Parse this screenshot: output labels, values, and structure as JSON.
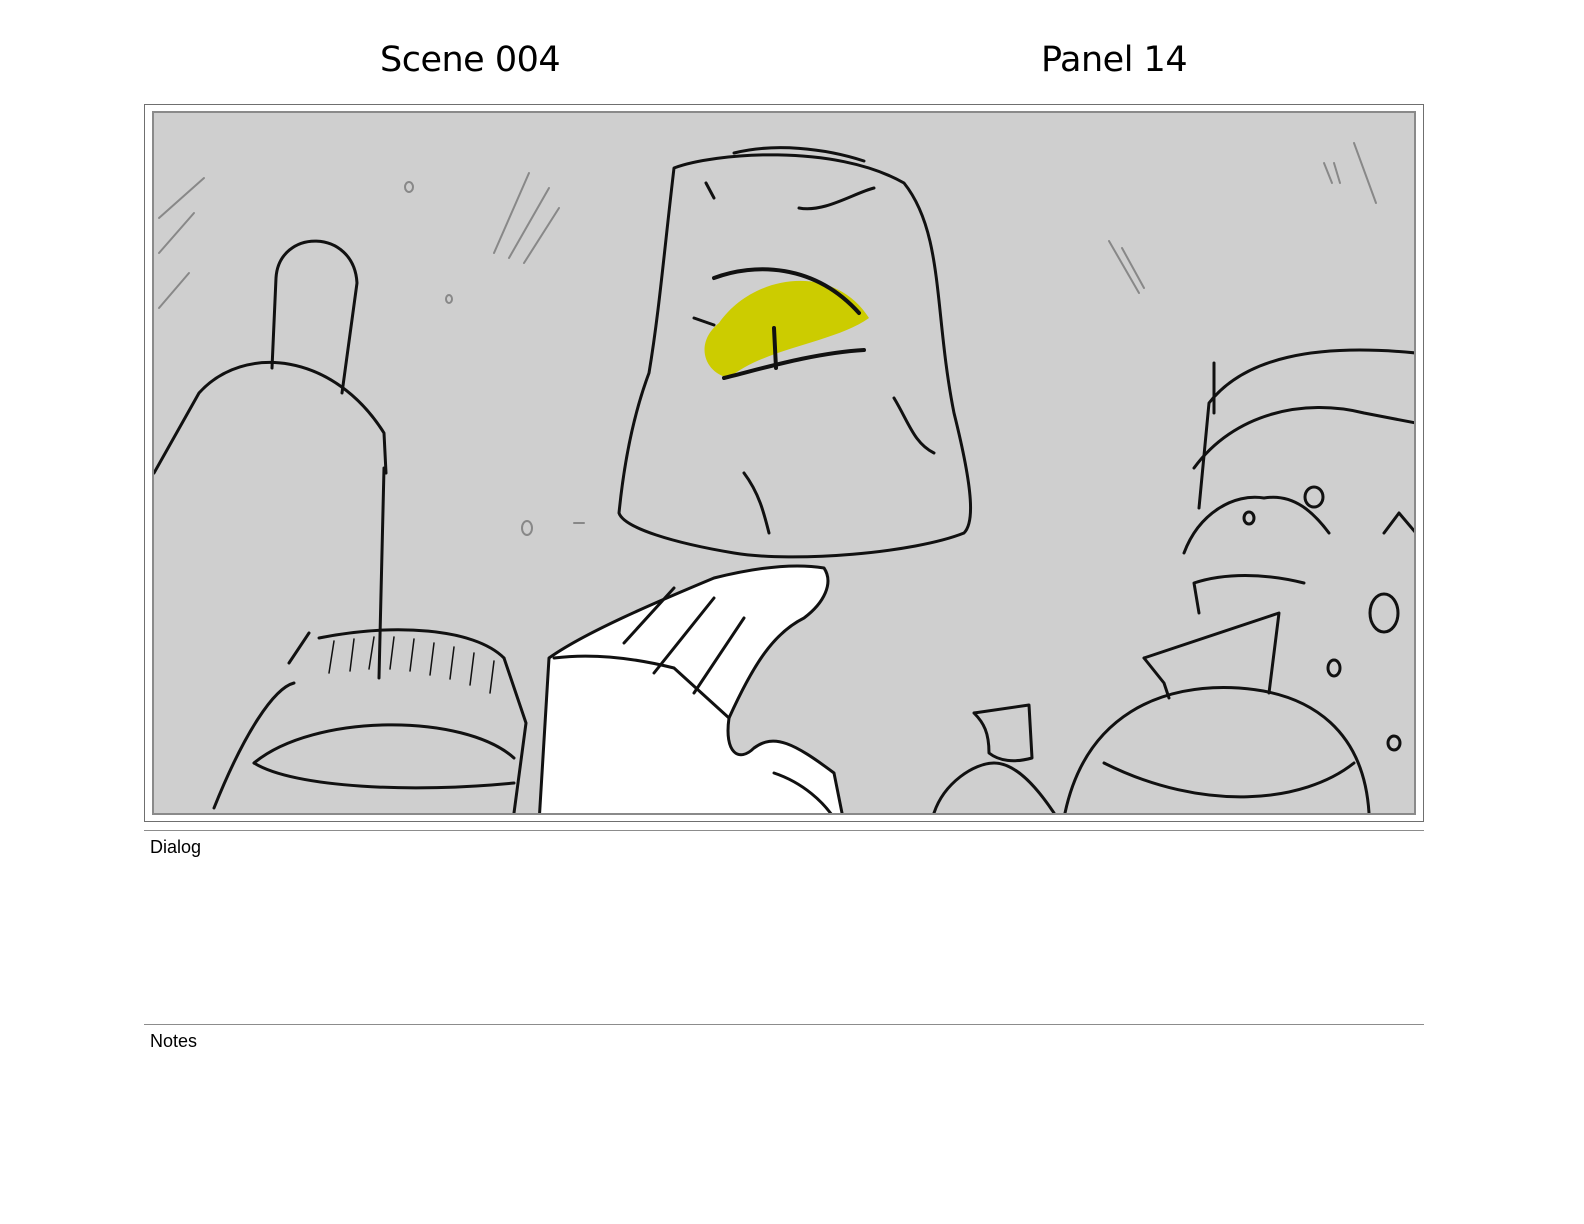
{
  "header": {
    "scene": "Scene 004",
    "panel": "Panel 14"
  },
  "sections": {
    "dialog_label": "Dialog",
    "dialog_text": "",
    "notes_label": "Notes",
    "notes_text": ""
  },
  "artwork": {
    "description_icon": "storyboard-sketch",
    "colors": {
      "background": "#cfcfcf",
      "eye": "#cccc00",
      "line": "#111111",
      "hand": "#ffffff"
    }
  }
}
